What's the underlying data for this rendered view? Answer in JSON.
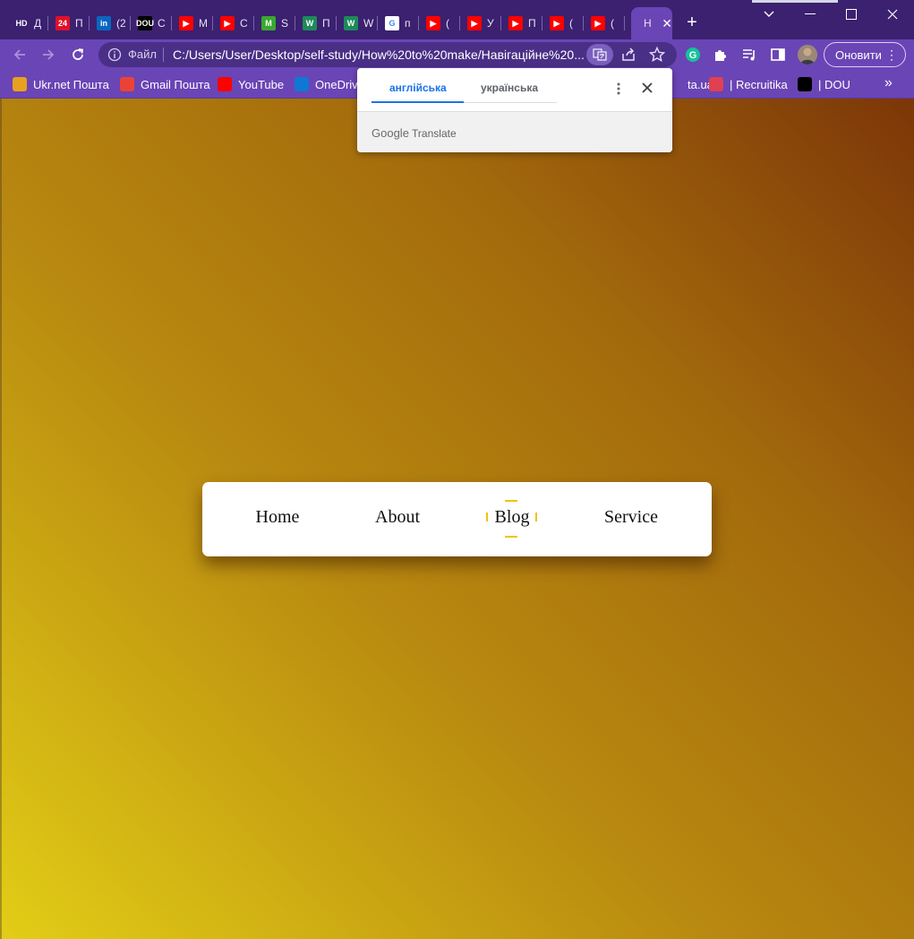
{
  "browser": {
    "tabs": [
      {
        "icon": "hd-icon",
        "color": "#3b2170",
        "badge": "HD",
        "title": "Д"
      },
      {
        "icon": "24-icon",
        "color": "#e0102a",
        "badge": "24",
        "title": "П"
      },
      {
        "icon": "linkedin-icon",
        "color": "#0a66c2",
        "badge": "in",
        "title": "(2"
      },
      {
        "icon": "dou-icon",
        "color": "#000000",
        "badge": "DOU",
        "title": "C"
      },
      {
        "icon": "youtube-icon",
        "color": "#ff0000",
        "badge": "▶",
        "title": "M"
      },
      {
        "icon": "youtube-icon",
        "color": "#ff0000",
        "badge": "▶",
        "title": "C"
      },
      {
        "icon": "m-icon",
        "color": "#3aa830",
        "badge": "M",
        "title": "S"
      },
      {
        "icon": "w-icon",
        "color": "#1d8a5a",
        "badge": "W",
        "title": "П"
      },
      {
        "icon": "w-icon",
        "color": "#1d8a5a",
        "badge": "W",
        "title": "W"
      },
      {
        "icon": "google-icon",
        "color": "#ffffff",
        "badge": "G",
        "title": "п"
      },
      {
        "icon": "youtube-icon",
        "color": "#ff0000",
        "badge": "▶",
        "title": "("
      },
      {
        "icon": "youtube-icon",
        "color": "#ff0000",
        "badge": "▶",
        "title": "У"
      },
      {
        "icon": "youtube-icon",
        "color": "#ff0000",
        "badge": "▶",
        "title": "П"
      },
      {
        "icon": "youtube-icon",
        "color": "#ff0000",
        "badge": "▶",
        "title": "("
      },
      {
        "icon": "youtube-icon",
        "color": "#ff0000",
        "badge": "▶",
        "title": "("
      }
    ],
    "active_tab": {
      "title": "Н"
    },
    "address": {
      "file_label": "Файл",
      "url": "C:/Users/User/Desktop/self-study/How%20to%20make/Навігаційне%20..."
    },
    "update_label": "Оновити",
    "bookmarks": [
      {
        "icon": "ukrnet-icon",
        "color": "#e8a020",
        "label": "Ukr.net Пошта"
      },
      {
        "icon": "gmail-icon",
        "color": "#ea4335",
        "label": "Gmail Пошта"
      },
      {
        "icon": "youtube-icon",
        "color": "#ff0000",
        "label": "YouTube"
      },
      {
        "icon": "onedrive-icon",
        "color": "#0f78d4",
        "label": "OneDrive"
      },
      {
        "icon": "site-icon",
        "color": "#6a45b5",
        "label": "ta.ua"
      },
      {
        "icon": "recruitika-icon",
        "color": "#e04050",
        "label": "| Recruitika"
      },
      {
        "icon": "dou-icon",
        "color": "#000000",
        "label": "| DOU"
      }
    ]
  },
  "translate_popup": {
    "tab_source": "англійська",
    "tab_target": "українська",
    "brand_google": "Google",
    "brand_translate": "Translate"
  },
  "page": {
    "nav": [
      "Home",
      "About",
      "Blog",
      "Service"
    ],
    "active_item": "Blog",
    "accent": "#f0c30a",
    "gradient": [
      "#7c3608",
      "#e2cd16"
    ]
  }
}
